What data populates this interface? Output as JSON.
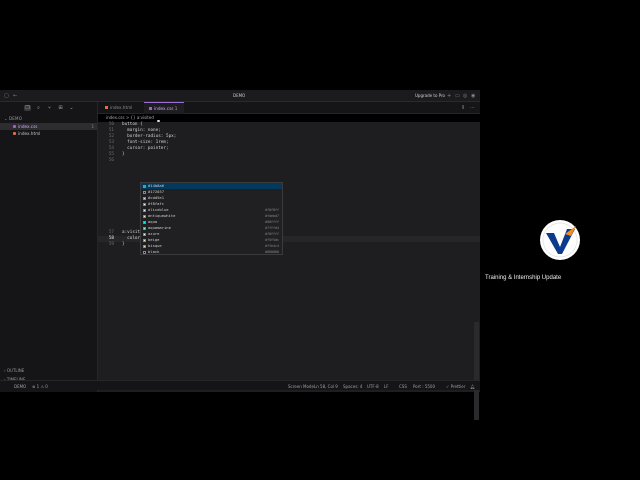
{
  "window": {
    "title": "DEMO",
    "upgrade_label": "Upgrade to Pro"
  },
  "sidebar": {
    "section": "DEMO",
    "files": [
      {
        "name": "index.css",
        "badge": "1"
      },
      {
        "name": "index.html",
        "badge": ""
      }
    ],
    "outline": "OUTLINE",
    "timeline": "TIMELINE"
  },
  "tabs": [
    {
      "label": "index.html"
    },
    {
      "label": "index.css",
      "modified_mark": "1"
    }
  ],
  "breadcrumb": "index.css  >  {} a:visited",
  "code": {
    "lines": [
      {
        "n": "50",
        "text": "button {"
      },
      {
        "n": "51",
        "text": "  margin: none;"
      },
      {
        "n": "52",
        "text": "  border-radius: 5px;"
      },
      {
        "n": "53",
        "text": "  font-size: 1rem;"
      },
      {
        "n": "54",
        "text": "  cursor: pointer;"
      },
      {
        "n": "55",
        "text": "}"
      },
      {
        "n": "56",
        "text": ""
      },
      {
        "n": "57",
        "text": "a:visited {"
      },
      {
        "n": "58",
        "text": "  color: |"
      },
      {
        "n": "59",
        "text": "}"
      }
    ]
  },
  "suggestions": [
    {
      "label": "#14b8a6",
      "hex": "",
      "color": "#14b8a6"
    },
    {
      "label": "#172037",
      "hex": "",
      "color": "#172037"
    },
    {
      "label": "#cdd5e1",
      "hex": "",
      "color": "#cdd5e1"
    },
    {
      "label": "#f8fafc",
      "hex": "",
      "color": "#f8fafc"
    },
    {
      "label": "aliceblue",
      "hex": "#f0f8ff",
      "color": "#f0f8ff"
    },
    {
      "label": "antiquewhite",
      "hex": "#faebd7",
      "color": "#faebd7"
    },
    {
      "label": "aqua",
      "hex": "#00ffff",
      "color": "#00ffff"
    },
    {
      "label": "aquamarine",
      "hex": "#7fffd4",
      "color": "#7fffd4"
    },
    {
      "label": "azure",
      "hex": "#f0ffff",
      "color": "#f0ffff"
    },
    {
      "label": "beige",
      "hex": "#f5f5dc",
      "color": "#f5f5dc"
    },
    {
      "label": "bisque",
      "hex": "#ffe4c4",
      "color": "#ffe4c4"
    },
    {
      "label": "black",
      "hex": "#000000",
      "color": "#000000"
    }
  ],
  "status": {
    "branch": "DEMO",
    "problems": "⊗ 1  ⚠ 0",
    "screen_reader": "Screen Mode",
    "position": "Ln 58, Col 9",
    "spaces": "Spaces: 4",
    "encoding": "UTF-8",
    "eol": "LF",
    "language": "CSS",
    "port": "Port : 5500",
    "formatter": "✓ Prettier"
  },
  "overlay": {
    "title": "Training & Internship Update"
  },
  "colors": {
    "accent": "#9b6fd6",
    "logo_blue": "#0d3b8c",
    "logo_orange": "#f28c1c"
  }
}
